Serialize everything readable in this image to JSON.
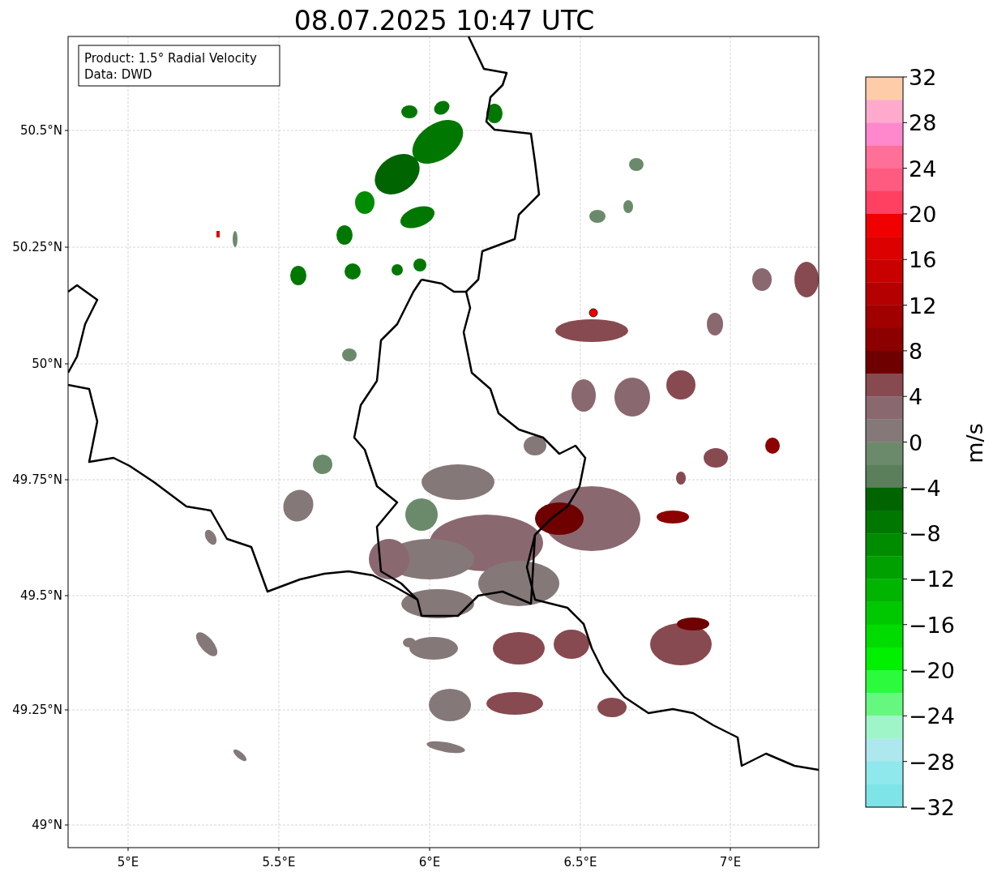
{
  "title": "08.07.2025 10:47 UTC",
  "legend": {
    "lines": [
      "Product: 1.5° Radial Velocity",
      "Data: DWD"
    ]
  },
  "map": {
    "x_ticks": [
      "5°E",
      "5.5°E",
      "6°E",
      "6.5°E",
      "7°E"
    ],
    "y_ticks": [
      "50.5°N",
      "50.25°N",
      "50°N",
      "49.75°N",
      "49.5°N",
      "49.25°N",
      "49°N"
    ]
  },
  "colorbar": {
    "label": "m/s",
    "ticks": [
      "32",
      "28",
      "24",
      "20",
      "16",
      "12",
      "8",
      "4",
      "0",
      "−4",
      "−8",
      "−12",
      "−16",
      "−20",
      "−24",
      "−28",
      "−32"
    ],
    "bands": [
      {
        "color": "#ffccaa"
      },
      {
        "color": "#ffaacc"
      },
      {
        "color": "#ff88cc"
      },
      {
        "color": "#ff7099"
      },
      {
        "color": "#ff5a80"
      },
      {
        "color": "#ff4060"
      },
      {
        "color": "#f00000"
      },
      {
        "color": "#dc0000"
      },
      {
        "color": "#c80000"
      },
      {
        "color": "#b40000"
      },
      {
        "color": "#a00000"
      },
      {
        "color": "#8c0000"
      },
      {
        "color": "#6e0000"
      },
      {
        "color": "#874a50"
      },
      {
        "color": "#8a6870"
      },
      {
        "color": "#857878"
      },
      {
        "color": "#6b8a6b"
      },
      {
        "color": "#5a7f5a"
      },
      {
        "color": "#006400"
      },
      {
        "color": "#007800"
      },
      {
        "color": "#008c00"
      },
      {
        "color": "#00a000"
      },
      {
        "color": "#00b400"
      },
      {
        "color": "#00c800"
      },
      {
        "color": "#00dc00"
      },
      {
        "color": "#00f000"
      },
      {
        "color": "#2cfa3c"
      },
      {
        "color": "#66f77f"
      },
      {
        "color": "#9ff5c8"
      },
      {
        "color": "#ace8ee"
      },
      {
        "color": "#8ee8ec"
      },
      {
        "color": "#7ee4e8"
      }
    ]
  }
}
